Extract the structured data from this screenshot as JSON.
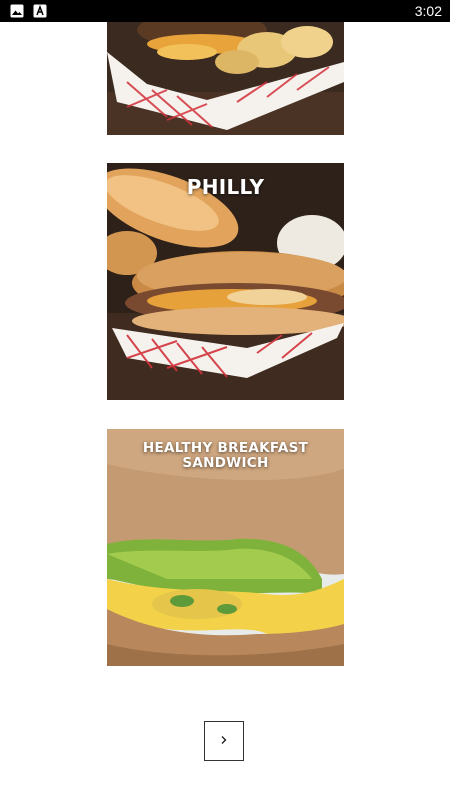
{
  "status_bar": {
    "time": "3:02",
    "icons": [
      "image-icon",
      "app-icon"
    ],
    "background": "#000000"
  },
  "recipes": [
    {
      "title": ""
    },
    {
      "title": "PHILLY"
    },
    {
      "title": "HEALTHY BREAKFAST SANDWICH"
    }
  ],
  "pagination": {
    "next_icon": "chevron-right-icon",
    "next_glyph": "›"
  }
}
